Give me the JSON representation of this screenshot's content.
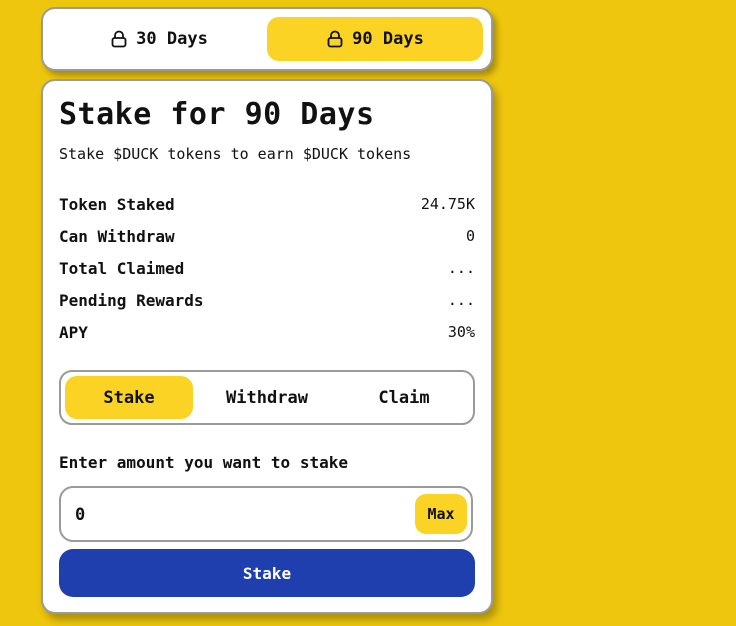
{
  "period_selector": {
    "options": [
      {
        "label": "30 Days",
        "icon": "lock-icon",
        "selected": false
      },
      {
        "label": "90 Days",
        "icon": "lock-icon",
        "selected": true
      }
    ]
  },
  "stake_card": {
    "title": "Stake for 90 Days",
    "subtitle": "Stake $DUCK tokens to earn $DUCK tokens",
    "stats": [
      {
        "label": "Token Staked",
        "value": "24.75K"
      },
      {
        "label": "Can Withdraw",
        "value": "0"
      },
      {
        "label": "Total Claimed",
        "value": "..."
      },
      {
        "label": "Pending Rewards",
        "value": "..."
      },
      {
        "label": "APY",
        "value": "30%"
      }
    ],
    "action_tabs": [
      {
        "label": "Stake",
        "selected": true
      },
      {
        "label": "Withdraw",
        "selected": false
      },
      {
        "label": "Claim",
        "selected": false
      }
    ],
    "amount_label": "Enter amount you want to stake",
    "amount_value": "0",
    "max_label": "Max",
    "submit_label": "Stake"
  },
  "colors": {
    "background": "#eec60d",
    "accent_yellow": "#fbd325",
    "primary_blue": "#1e3fad",
    "card": "#ffffff",
    "border": "#9a9a9a"
  }
}
